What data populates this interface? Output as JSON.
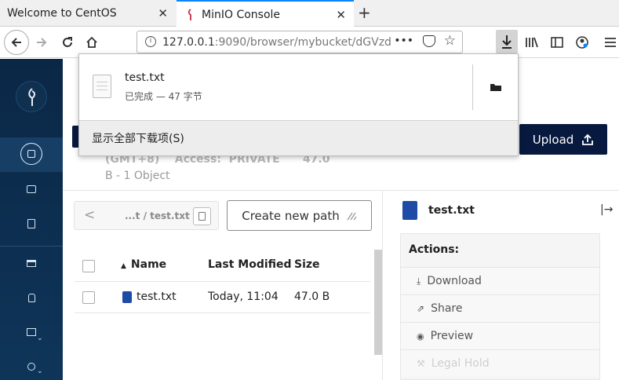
{
  "browser": {
    "tabs": [
      {
        "title": "Welcome to CentOS"
      },
      {
        "title": "MinIO Console"
      }
    ],
    "url_host": "127.0.0.1",
    "url_rest": ":9090/browser/mybucket/dGVzd"
  },
  "download_panel": {
    "file_name": "test.txt",
    "status": "已完成 — 47 字节",
    "show_all_label": "显示全部下载项(S)"
  },
  "header": {
    "upload_label": "Upload",
    "meta_line": "(GMT+8)    Access:  PRIVATE      47.0",
    "objects_line": "B - 1 Object"
  },
  "breadcrumb": {
    "path": "...t  /  test.txt"
  },
  "create_path_label": "Create new path",
  "table": {
    "columns": [
      "Name",
      "Last Modified",
      "Size"
    ],
    "rows": [
      {
        "name": "test.txt",
        "modified": "Today, 11:04",
        "size": "47.0 B"
      }
    ]
  },
  "details": {
    "file_name": "test.txt",
    "actions_title": "Actions:",
    "actions": [
      "Download",
      "Share",
      "Preview",
      "Legal Hold"
    ]
  },
  "colors": {
    "sidebar": "#0b2746",
    "accent": "#07193e",
    "file_icon": "#1d4ba6"
  }
}
